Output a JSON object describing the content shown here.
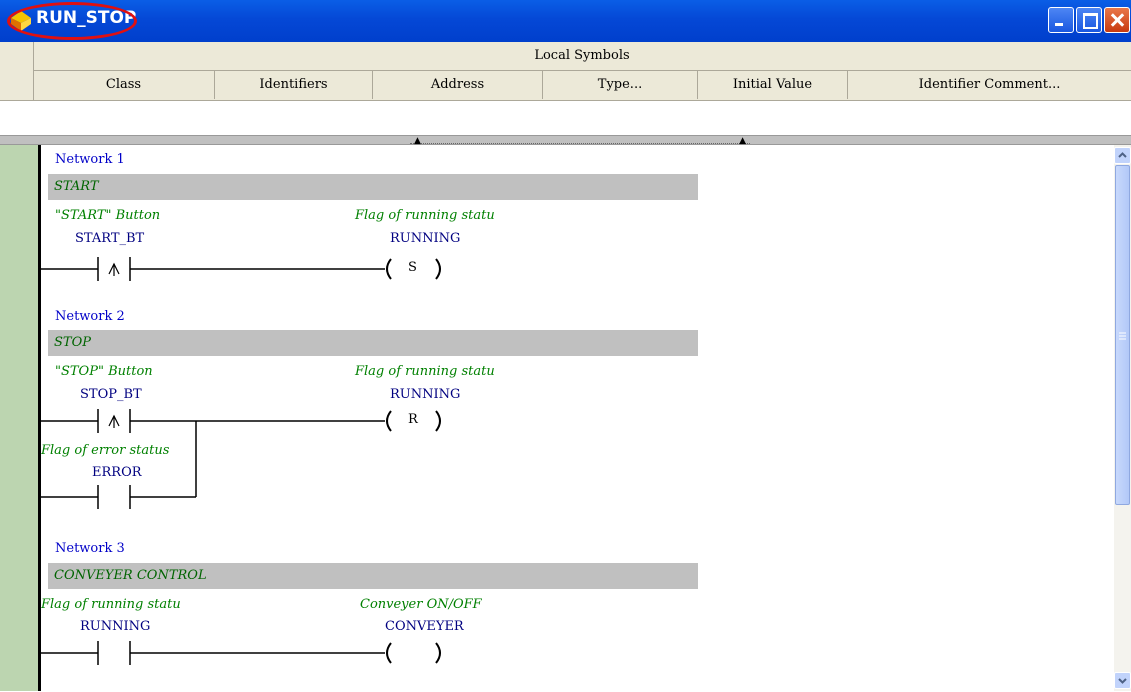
{
  "window": {
    "title": "RUN_STOP"
  },
  "local_symbols": {
    "title": "Local Symbols",
    "columns": [
      "Class",
      "Identifiers",
      "Address",
      "Type...",
      "Initial Value",
      "Identifier Comment..."
    ]
  },
  "networks": [
    {
      "label": "Network 1",
      "comment": "START",
      "contact": {
        "comment": "\"START\" Button",
        "name": "START_BT",
        "type": "rising-edge"
      },
      "coil": {
        "comment": "Flag of running statu",
        "name": "RUNNING",
        "symbol": "S"
      }
    },
    {
      "label": "Network 2",
      "comment": "STOP",
      "contact": {
        "comment": "\"STOP\" Button",
        "name": "STOP_BT",
        "type": "rising-edge"
      },
      "parallel_contact": {
        "comment": "Flag of error status",
        "name": "ERROR",
        "type": "normally-open"
      },
      "coil": {
        "comment": "Flag of running statu",
        "name": "RUNNING",
        "symbol": "R"
      }
    },
    {
      "label": "Network 3",
      "comment": "CONVEYER CONTROL",
      "contact": {
        "comment": "Flag of running statu",
        "name": "RUNNING",
        "type": "normally-open"
      },
      "coil": {
        "comment": "Conveyer ON/OFF",
        "name": "CONVEYER",
        "symbol": ""
      }
    }
  ],
  "colors": {
    "title_bar": "#0548d6",
    "network_label": "#0000c8",
    "comment": "#008000",
    "operand": "#000080",
    "left_gutter": "#bcd5b0"
  }
}
